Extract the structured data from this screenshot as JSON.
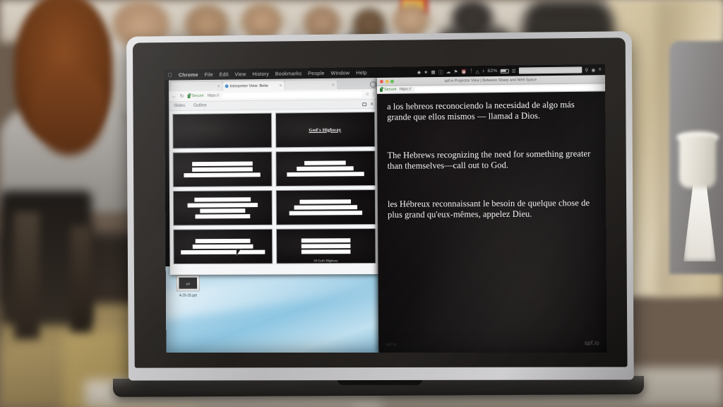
{
  "scene": {
    "description": "Laptop on a table in a cafe/auditorium showing a bilingual caption projector view",
    "device": "laptop"
  },
  "menubar": {
    "apple_icon": "apple-logo",
    "items": [
      "Chrome",
      "File",
      "Edit",
      "View",
      "History",
      "Bookmarks",
      "People",
      "Window",
      "Help"
    ],
    "status": {
      "bluetooth_icon": "bluetooth-icon",
      "wifi_icon": "wifi-icon",
      "volume_icon": "volume-icon",
      "clock_icon": "clock-icon",
      "battery_percent": "82%",
      "battery_icon": "battery-icon",
      "spotlight_icon": "search-icon",
      "siri_icon": "siri-icon",
      "controlcenter_icon": "list-icon"
    }
  },
  "left_window": {
    "tabs": [
      {
        "label": "",
        "active": false
      },
      {
        "label": "Interpreter View: Betw",
        "active": true
      },
      {
        "label": "",
        "active": false
      }
    ],
    "omnibar": {
      "back_icon": "back-arrow-icon",
      "reload_icon": "reload-icon",
      "secure_label": "Secure",
      "lock_icon": "lock-icon",
      "url": "https://",
      "bookmark_icon": "bookmark-icon",
      "menu_icon": "kebab-menu-icon"
    },
    "slides_panel": {
      "tabs": [
        "Slides",
        "Outline"
      ],
      "popout_icon": "popout-icon",
      "close_icon": "close-icon"
    },
    "thumbnails": [
      {
        "index": 1,
        "title": "",
        "bars": [],
        "footer": ""
      },
      {
        "index": 2,
        "title": "God's Highway",
        "bars": [],
        "footer": ""
      },
      {
        "index": 3,
        "title": "",
        "bars": [
          62,
          62,
          78
        ],
        "footer": ""
      },
      {
        "index": 4,
        "title": "",
        "bars": [
          42,
          58,
          78
        ],
        "footer": ""
      },
      {
        "index": 5,
        "title": "",
        "bars": [
          58,
          72,
          46,
          56
        ],
        "footer": ""
      },
      {
        "index": 6,
        "title": "",
        "bars": [
          52,
          64,
          74
        ],
        "footer": ""
      },
      {
        "index": 7,
        "title": "",
        "bars": [
          56,
          62,
          86
        ],
        "footer": ""
      },
      {
        "index": 8,
        "title": "",
        "bars": [
          50,
          50,
          50
        ],
        "footer": "Of God's Highway"
      }
    ]
  },
  "desktop": {
    "file_icon": {
      "name": "4-29-18.ppt",
      "thumb_label": "ppt"
    }
  },
  "right_window": {
    "titlebar": {
      "title": "spf.io Projector View | Between Sharp and Well Space",
      "close_icon": "close-traffic-light",
      "minimize_icon": "minimize-traffic-light",
      "zoom_icon": "zoom-traffic-light"
    },
    "omnibar": {
      "secure_label": "Secure",
      "lock_icon": "lock-icon",
      "url": "https://"
    },
    "captions": {
      "spanish": "a los hebreos reconociendo la necesidad de algo más grande que ellos mismos — llamad a Dios.",
      "english": "The Hebrews recognizing the need for something greater than themselves—call out to God.",
      "french": "les Hébreux reconnaissant le besoin de quelque chose de plus grand qu'eux-mêmes, appelez Dieu."
    },
    "watermark": "spf.io",
    "watermark_left": "spf.io"
  },
  "colors": {
    "caption_text": "#ffffff",
    "stage_bg": "#0d0b0c",
    "desktop_bg": "#8ec6e2",
    "chrome_ui": "#f1f1f1",
    "secure_green": "#2e7d32"
  }
}
